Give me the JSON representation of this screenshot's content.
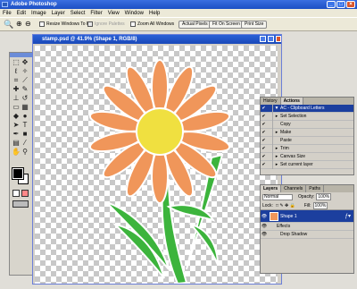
{
  "app": {
    "title": "Adobe Photoshop",
    "menu": [
      "File",
      "Edit",
      "Image",
      "Layer",
      "Select",
      "Filter",
      "View",
      "Window",
      "Help"
    ]
  },
  "options": {
    "resize_label": "Resize Windows To Fit",
    "ignore_palettes": "Ignore Palettes",
    "zoom_all": "Zoom All Windows",
    "actual_pixels": "Actual Pixels",
    "fit_on_screen": "Fit On Screen",
    "print_size": "Print Size"
  },
  "document": {
    "title": "stamp.psd @ 41.9% (Shape 1, RGB/8)"
  },
  "actions": {
    "tabs": [
      "History",
      "Actions"
    ],
    "items": [
      {
        "label": "AC - Clipboard Letters",
        "selected": true
      },
      {
        "label": "Set Selection"
      },
      {
        "label": "Copy"
      },
      {
        "label": "Make"
      },
      {
        "label": "Paste"
      },
      {
        "label": "Trim"
      },
      {
        "label": "Canvas Size"
      },
      {
        "label": "Set current layer"
      }
    ]
  },
  "layers": {
    "tabs": [
      "Layers",
      "Channels",
      "Paths"
    ],
    "blend": "Normal",
    "opacity_label": "Opacity:",
    "opacity": "100%",
    "lock_label": "Lock:",
    "fill_label": "Fill:",
    "fill": "100%",
    "items": [
      {
        "label": "Shape 1",
        "selected": true
      },
      {
        "label": "Effects"
      },
      {
        "label": "Drop Shadow"
      }
    ]
  },
  "colors": {
    "accent": "#2b61d6",
    "petal": "#f0965a",
    "center": "#f0e040",
    "leaf": "#3cb43c"
  }
}
